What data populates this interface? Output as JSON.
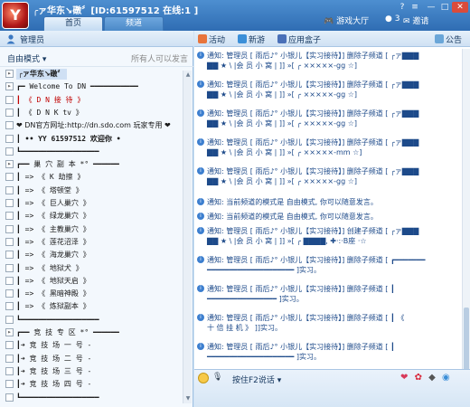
{
  "window": {
    "title": "╭ァ华东↘礅〞[ID:61597512 在线:1 ]",
    "tabs": [
      "首页",
      "频道"
    ],
    "game_hall": "游戏大厅",
    "coins": "3",
    "invite": "邀请",
    "controls": [
      "?",
      "≡",
      "—",
      "□",
      "✕"
    ]
  },
  "left_panel": {
    "header": "管理员",
    "mode": "自由模式",
    "mode_note": "所有人可以发言",
    "tree": [
      {
        "text": "╭ァ华东↘礅〞",
        "type": "root",
        "box": "▸"
      },
      {
        "text": "┏━ Welcome To DN ━━━━━━━━━━━",
        "type": "plain",
        "box": "▸"
      },
      {
        "text": "┃    《 D N 接 待 》",
        "type": "red",
        "box": ""
      },
      {
        "text": "┃    《 D N K  tv 》",
        "type": "plain",
        "box": ""
      },
      {
        "text": "❤ DN官方网址:http://dn.sdo.com 玩家专用 ❤",
        "type": "url",
        "box": ""
      },
      {
        "text": "┃  •• YY 61597512  欢迎你 •",
        "type": "yy",
        "box": ""
      },
      {
        "text": "┗━━━━━━━━━━━━━━━━━━",
        "type": "plain",
        "box": ""
      },
      {
        "text": "┏━━ 巢 穴 副 本 *° ━━━━━━",
        "type": "plain",
        "box": "▸"
      },
      {
        "text": "┃   =>     《 K 劫擦 》",
        "type": "plain",
        "box": ""
      },
      {
        "text": "┃   =>     《 塔顿堂 》",
        "type": "plain",
        "box": ""
      },
      {
        "text": "┃   =>     《 巨人巢穴 》",
        "type": "plain",
        "box": ""
      },
      {
        "text": "┃   =>     《 绿龙巢穴 》",
        "type": "plain",
        "box": ""
      },
      {
        "text": "┃   =>     《 主教巢穴 》",
        "type": "plain",
        "box": ""
      },
      {
        "text": "┃   =>     《 莲花沼泽 》",
        "type": "plain",
        "box": ""
      },
      {
        "text": "┃   =>     《 海龙巢穴 》",
        "type": "plain",
        "box": ""
      },
      {
        "text": "┃   =>     《 地狱犬 》",
        "type": "plain",
        "box": ""
      },
      {
        "text": "┃   =>     《 地狱天启 》",
        "type": "plain",
        "box": ""
      },
      {
        "text": "┃   =>     《 黑暗神殿 》",
        "type": "plain",
        "box": ""
      },
      {
        "text": "┃   =>     《 炼狱副本 》",
        "type": "plain",
        "box": ""
      },
      {
        "text": "┗━━━━━━━━━━━━━━━━━━",
        "type": "plain",
        "box": ""
      },
      {
        "text": "┏━━ 竞 技 专 区 *° ━━━━━━",
        "type": "plain",
        "box": "▸"
      },
      {
        "text": "┃➜   竞 技 场 一 号  -",
        "type": "plain",
        "box": ""
      },
      {
        "text": "┃➜   竞 技 场 二 号  -",
        "type": "plain",
        "box": ""
      },
      {
        "text": "┃➜   竞 技 场 三 号  -",
        "type": "plain",
        "box": ""
      },
      {
        "text": "┃➜   竞 技 场 四 号  -",
        "type": "plain",
        "box": ""
      },
      {
        "text": "┗━━━━━━━━━━━━━━━━━━",
        "type": "plain",
        "box": ""
      }
    ]
  },
  "right_panel": {
    "toolbar": {
      "activity": "活动",
      "new": "新游",
      "apps": "应用盒子",
      "notice": "公告"
    },
    "messages": [
      {
        "l1": "通知: 管理员 [ 雨后♪° 小银儿【实习接待】] 删除子频道 [ ╭ァ▇▇▇",
        "l2": "▇▇ ★ \\  |会 员 小 窝 |  ]] »[ ╭ ×××××-gg ☆]"
      },
      {
        "l1": "通知: 管理员 [ 雨后♪° 小银儿【实习接待】] 删除子频道 [ ╭ァ▇▇▇",
        "l2": "▇▇ ★ \\  |会 员 小 窝 |  ]] »[ ╭ ×××××-gg ☆]"
      },
      {
        "l1": "通知: 管理员 [ 雨后♪° 小银儿【实习接待】] 删除子频道 [ ╭ァ▇▇▇",
        "l2": "▇▇ ★ \\  |会 员 小 窝 |  ]] »[ ╭ ×××××-gg ☆]"
      },
      {
        "l1": "通知: 管理员 [ 雨后♪° 小银儿【实习接待】] 删除子频道 [ ╭ァ▇▇▇",
        "l2": "▇▇ ★ \\  |会 员 小 窝 |  ]] »[ ╭ ×××××-mm ☆]"
      },
      {
        "l1": "通知: 管理员 [ 雨后♪° 小银儿【实习接待】] 删除子频道 [ ╭ァ▇▇▇",
        "l2": "▇▇ ★ \\  |会 员 小 窝 |  ]] »[ ╭ ×××××-gg ☆]"
      },
      {
        "l1": "通知: 当前频道的模式是 自由模式, 你可以随意发言。",
        "l2": ""
      },
      {
        "l1": "通知: 当前频道的模式是 自由模式, 你可以随意发言。",
        "l2": ""
      },
      {
        "l1": "通知: 管理员 [ 雨后♪° 小银儿【实习接待】] 创建子频道 [ ╭ァ▇▇▇",
        "l2": "▇▇ ★ \\  |会 员 小 窝 |  ]] »[ ╭ ▇▇▇▇,  ✚·:·B座 ·☆"
      },
      {
        "l1": "通知: 管理员 [ 雨后♪° 小银儿【实习接待】] 删除子频道 [ ┏━━━━━━━",
        "l2": "━━━━━━━━━━━━━━━━━━━━ ]实习。"
      },
      {
        "l1": "通知: 管理员 [ 雨后♪° 小银儿【实习接待】] 删除子频道 [ ┃",
        "l2": "━━━━━━━━━━━━━━━━   ]实习。"
      },
      {
        "l1": "通知: 管理员 [ 雨后♪° 小银儿【实习接待】] 删除子频道 [ ┃     《",
        "l2": "  十 倍 挂 机  》     ]]实习。"
      },
      {
        "l1": "通知: 管理员 [ 雨后♪° 小银儿【实习接待】] 删除子频道 [ ┃",
        "l2": "━━━━━━━━━━━━━━━━━━━━ ]实习。"
      },
      {
        "l1": "通知: 管理员 [ 雨后♪° 小银儿【实习接待】] 删除子频道 [ ┗━━━━━━━",
        "l2": "━━━━━━━━━━━━━━━━━━━━ ]实习。"
      }
    ],
    "bottom": {
      "ptt": "按住F2说话"
    }
  }
}
